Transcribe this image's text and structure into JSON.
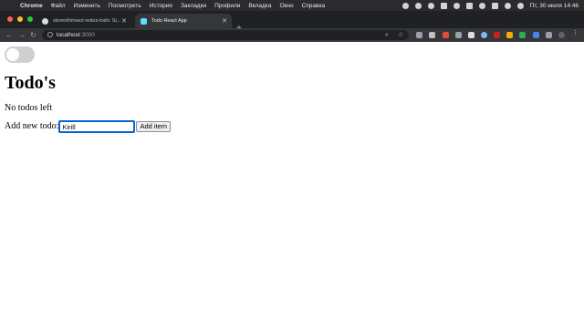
{
  "menubar": {
    "app": "Chrome",
    "items": [
      "Файл",
      "Изменить",
      "Посмотреть",
      "История",
      "Закладки",
      "Профили",
      "Вкладка",
      "Окно",
      "Справка"
    ],
    "datetime": "Пт, 30 июля 14:46"
  },
  "tabs": [
    {
      "title": "storenth/react-redux-todo: Si...",
      "close": "✕"
    },
    {
      "title": "Todo React App",
      "close": "✕"
    }
  ],
  "new_tab": "+",
  "address": {
    "host": "localhost",
    "port": ":3000"
  },
  "page": {
    "heading": "Todo's",
    "status": "No todos left",
    "add_label": "Add new todo:",
    "input_value": "Kirill",
    "add_button": "Add item",
    "toggle_on": false
  },
  "colors": {
    "menubar_bg": "#2b2a2f",
    "tabstrip_bg": "#202124",
    "toolbar_bg": "#35363a",
    "input_focus": "#0b63d6",
    "toggle_off": "#cfcfcf"
  }
}
